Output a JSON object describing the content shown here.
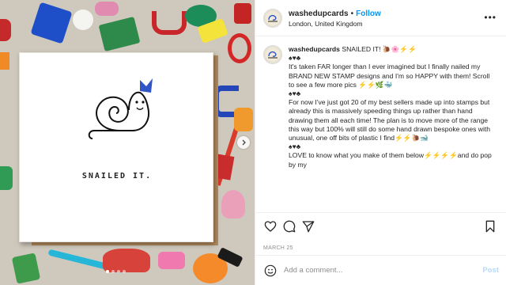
{
  "header": {
    "username": "washedupcards",
    "separator": "•",
    "follow_label": "Follow",
    "location": "London, United Kingdom",
    "more_label": "•••"
  },
  "media": {
    "card_caption": "SNAILED IT."
  },
  "caption": {
    "username": "washedupcards",
    "lines": [
      "SNAILED IT! 🐌🌸⚡⚡",
      "♠♥♣",
      "It's taken FAR longer than I ever imagined but I finally nailed my BRAND NEW STAMP designs and I'm so HAPPY with them! Scroll to see a few more pics ⚡⚡🌿🐳",
      "♠♥♣",
      "For now I've just got 20 of my best sellers made up into stamps but already this is massively speeding things up rather than hand drawing them all each time! The plan is to move more of the range this way but 100% will still do some hand drawn bespoke ones with unusual, one off bits of plastic I find⚡⚡🐌🐋",
      "♠♥♣",
      "LOVE to know what you make of them below⚡⚡⚡⚡and do pop by my"
    ]
  },
  "date": "MARCH 25",
  "comment": {
    "placeholder": "Add a comment...",
    "post_label": "Post"
  },
  "icons": {
    "like": "heart-icon",
    "comment": "comment-icon",
    "share": "share-icon",
    "save": "bookmark-icon",
    "emoji": "smiley-icon",
    "next": "chevron-right-icon"
  },
  "colors": {
    "follow": "#0095f6",
    "post_disabled": "#b3dbff",
    "muted": "#8e8e8e"
  }
}
